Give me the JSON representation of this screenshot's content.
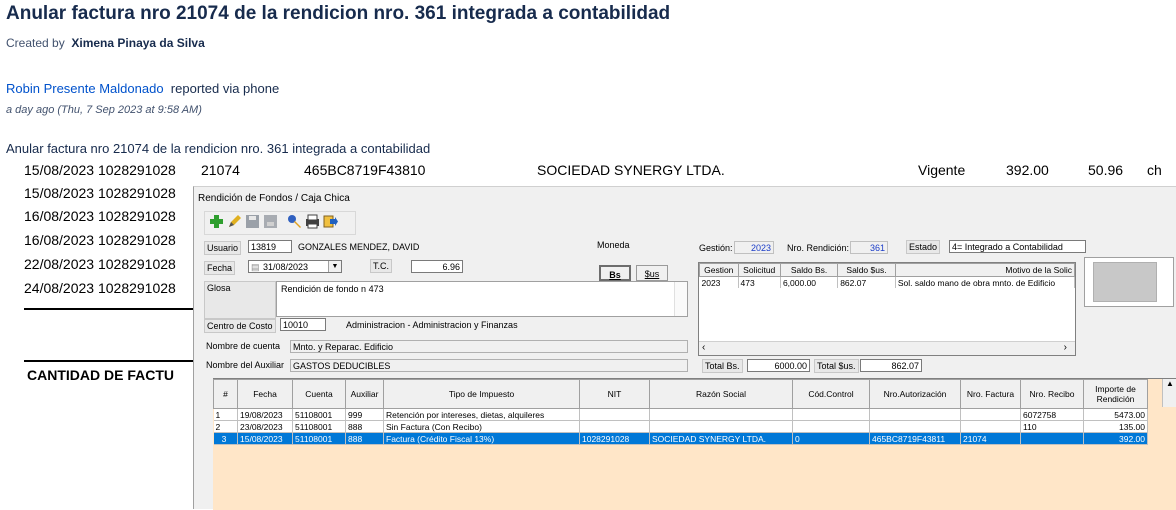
{
  "ticket": {
    "title": "Anular factura nro 21074 de la rendicion nro. 361 integrada a contabilidad",
    "created_by_label": "Created by",
    "created_by_name": "Ximena Pinaya da Silva",
    "reporter_name": "Robin Presente Maldonado",
    "reporter_suffix": "reported via phone",
    "timestamp": "a day ago (Thu, 7 Sep 2023 at 9:58 AM)",
    "description": "Anular factura nro 21074 de la rendicion nro. 361 integrada a contabilidad"
  },
  "background_table": {
    "first_row": {
      "date_nit": "15/08/2023 1028291028",
      "factura": "21074",
      "autorizacion": "465BC8719F43810",
      "razon": "SOCIEDAD SYNERGY LTDA.",
      "estado": "Vigente",
      "importe": "392.00",
      "iva": "50.96",
      "tipo": "ch"
    },
    "rows": [
      "15/08/2023 1028291028",
      "16/08/2023 1028291028",
      "16/08/2023 1028291028",
      "22/08/2023 1028291028",
      "24/08/2023 1028291028"
    ],
    "cantidad_label": "CANTIDAD DE FACTU"
  },
  "form": {
    "title": "Rendición de Fondos / Caja Chica",
    "usuario_label": "Usuario",
    "usuario_code": "13819",
    "usuario_name": "GONZALES MENDEZ, DAVID",
    "fecha_label": "Fecha",
    "fecha_value": "31/08/2023",
    "tc_label": "T.C.",
    "tc_value": "6.96",
    "glosa_label": "Glosa",
    "glosa_value": "Rendición de fondo n 473",
    "centro_label": "Centro de Costo",
    "centro_code": "10010",
    "centro_name": "Administracion - Administracion y Finanzas",
    "nombre_cuenta_label": "Nombre de cuenta",
    "nombre_cuenta_value": "Mnto. y Reparac. Edificio",
    "nombre_aux_label": "Nombre del Auxiliar",
    "nombre_aux_value": "GASTOS DEDUCIBLES",
    "moneda_label": "Moneda",
    "moneda_bs": "Bs",
    "moneda_us": "$us",
    "gestion_label": "Gestión:",
    "gestion_value": "2023",
    "nro_rendicion_label": "Nro. Rendición:",
    "nro_rendicion_value": "361",
    "estado_label": "Estado",
    "estado_value": "4= Integrado a Contabilidad",
    "total_bs_label": "Total Bs.",
    "total_bs_value": "6000.00",
    "total_us_label": "Total $us.",
    "total_us_value": "862.07"
  },
  "small_grid": {
    "headers": [
      "Gestion",
      "Solicitud",
      "Saldo Bs.",
      "Saldo $us.",
      "Motivo de la Solic"
    ],
    "row": [
      "2023",
      "473",
      "6,000.00",
      "862.07",
      "Sol.  saldo mano de obra mnto. de Edificio"
    ]
  },
  "main_grid": {
    "headers": [
      "#",
      "Fecha",
      "Cuenta",
      "Auxiliar",
      "Tipo de Impuesto",
      "NIT",
      "Razón Social",
      "Cód.Control",
      "Nro.Autorización",
      "Nro. Factura",
      "Nro. Recibo",
      "Importe de Rendición"
    ],
    "rows": [
      [
        "1",
        "19/08/2023",
        "51108001",
        "999",
        "Retención por intereses, dietas, alquileres",
        "",
        "",
        "",
        "",
        "",
        "6072758",
        "5473.00"
      ],
      [
        "2",
        "23/08/2023",
        "51108001",
        "888",
        "Sin Factura (Con Recibo)",
        "",
        "",
        "",
        "",
        "",
        "110",
        "135.00"
      ],
      [
        "3",
        "15/08/2023",
        "51108001",
        "888",
        "Factura (Crédito Fiscal 13%)",
        "1028291028",
        "SOCIEDAD SYNERGY LTDA.",
        "0",
        "465BC8719F43811",
        "21074",
        "",
        "392.00"
      ]
    ]
  },
  "colors": {
    "selected_row": "#0078d7",
    "grid_empty_area": "#ffe6c8",
    "link": "#0052cc"
  }
}
